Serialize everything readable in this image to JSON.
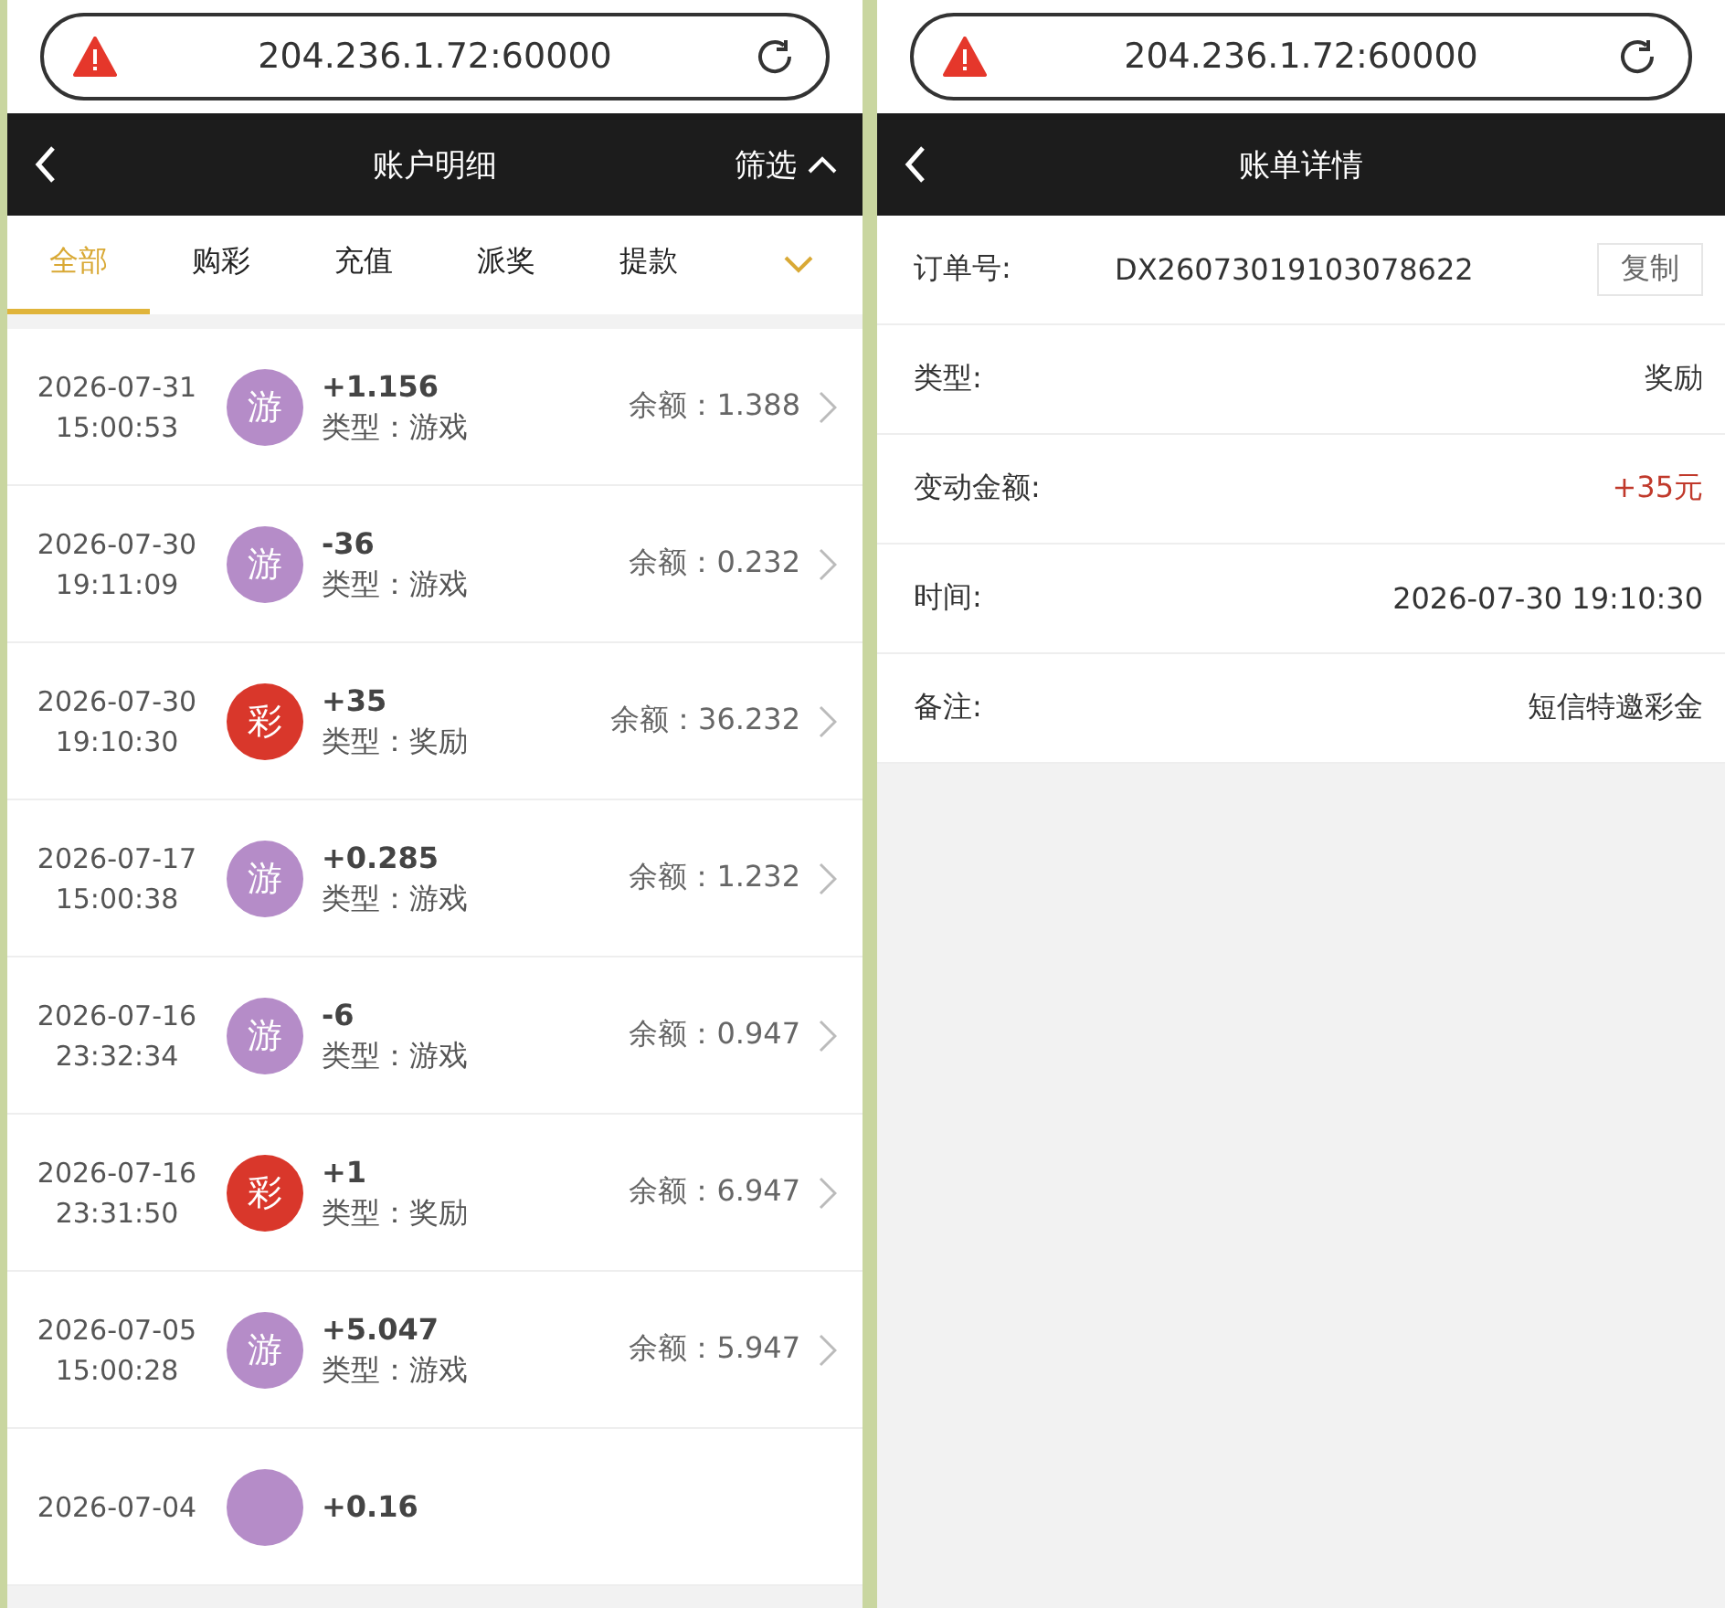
{
  "left_screen": {
    "address_bar": {
      "url": "204.236.1.72:60000"
    },
    "header": {
      "title": "账户明细",
      "filter": "筛选"
    },
    "tabs": [
      {
        "label": "全部",
        "selected": true
      },
      {
        "label": "购彩",
        "selected": false
      },
      {
        "label": "充值",
        "selected": false
      },
      {
        "label": "派奖",
        "selected": false
      },
      {
        "label": "提款",
        "selected": false
      }
    ],
    "records": [
      {
        "date": "2026-07-31",
        "time": "15:00:53",
        "icon": "游",
        "color": "#b58cc8",
        "amount": "+1.156",
        "type": "类型：游戏",
        "balance": "余额：1.388"
      },
      {
        "date": "2026-07-30",
        "time": "19:11:09",
        "icon": "游",
        "color": "#b58cc8",
        "amount": "-36",
        "type": "类型：游戏",
        "balance": "余额：0.232"
      },
      {
        "date": "2026-07-30",
        "time": "19:10:30",
        "icon": "彩",
        "color": "#d9372b",
        "amount": "+35",
        "type": "类型：奖励",
        "balance": "余额：36.232"
      },
      {
        "date": "2026-07-17",
        "time": "15:00:38",
        "icon": "游",
        "color": "#b58cc8",
        "amount": "+0.285",
        "type": "类型：游戏",
        "balance": "余额：1.232"
      },
      {
        "date": "2026-07-16",
        "time": "23:32:34",
        "icon": "游",
        "color": "#b58cc8",
        "amount": "-6",
        "type": "类型：游戏",
        "balance": "余额：0.947"
      },
      {
        "date": "2026-07-16",
        "time": "23:31:50",
        "icon": "彩",
        "color": "#d9372b",
        "amount": "+1",
        "type": "类型：奖励",
        "balance": "余额：6.947"
      },
      {
        "date": "2026-07-05",
        "time": "15:00:28",
        "icon": "游",
        "color": "#b58cc8",
        "amount": "+5.047",
        "type": "类型：游戏",
        "balance": "余额：5.947"
      },
      {
        "date": "2026-07-04",
        "color": "#b58cc8",
        "amount": "+0.16"
      }
    ]
  },
  "right_screen": {
    "address_bar": {
      "url": "204.236.1.72:60000"
    },
    "header": {
      "title": "账单详情"
    },
    "details": [
      {
        "label": "订单号:",
        "value": "DX26073019103078622",
        "button": "复制",
        "highlight": false
      },
      {
        "label": "类型:",
        "value": "奖励",
        "highlight": false
      },
      {
        "label": "变动金额:",
        "value": "+35元",
        "highlight": true
      },
      {
        "label": "时间:",
        "value": "2026-07-30 19:10:30",
        "highlight": false
      },
      {
        "label": "备注:",
        "value": "短信特邀彩金",
        "highlight": false
      }
    ]
  }
}
